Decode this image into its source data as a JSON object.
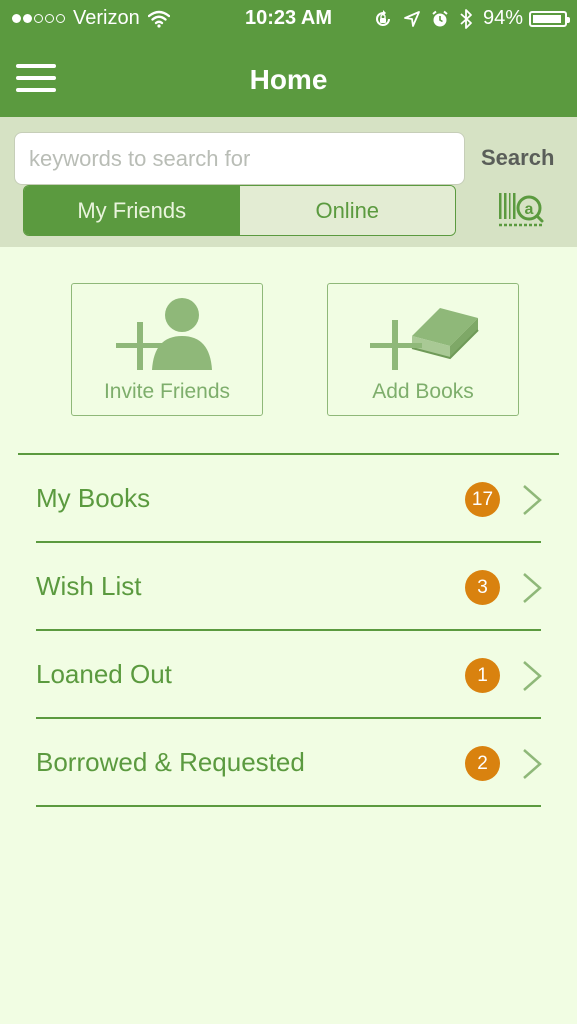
{
  "status_bar": {
    "carrier": "Verizon",
    "signal_bars_filled": 2,
    "signal_bars_total": 5,
    "time": "10:23 AM",
    "battery_percent": "94%",
    "battery_level": 0.94,
    "icons": [
      "wifi-icon",
      "orientation-lock-icon",
      "location-icon",
      "alarm-icon",
      "bluetooth-icon",
      "battery-icon"
    ]
  },
  "header": {
    "title": "Home",
    "menu_icon": "hamburger-menu-icon"
  },
  "search": {
    "placeholder": "keywords to search for",
    "value": "",
    "button_label": "Search",
    "scan_icon": "barcode-scan-icon"
  },
  "segments": {
    "items": [
      {
        "label": "My Friends",
        "active": true
      },
      {
        "label": "Online",
        "active": false
      }
    ]
  },
  "actions": [
    {
      "label": "Invite Friends",
      "icon": "add-person-icon"
    },
    {
      "label": "Add Books",
      "icon": "add-book-icon"
    }
  ],
  "list": [
    {
      "label": "My Books",
      "count": "17"
    },
    {
      "label": "Wish List",
      "count": "3"
    },
    {
      "label": "Loaned Out",
      "count": "1"
    },
    {
      "label": "Borrowed & Requested",
      "count": "2"
    }
  ],
  "colors": {
    "primary_green": "#5b9a3f",
    "background": "#f1fde3",
    "search_area": "#d6e2c4",
    "badge_orange": "#d9820f",
    "tile_icon_green": "#8fb879"
  }
}
